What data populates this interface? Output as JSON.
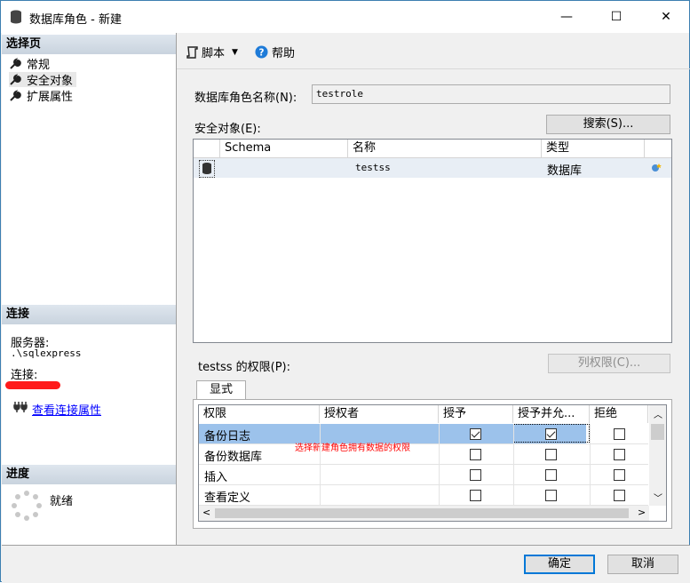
{
  "window": {
    "title": "数据库角色 - 新建",
    "controls": {
      "minimize": "—",
      "maximize": "☐",
      "close": "✕"
    }
  },
  "sidebar": {
    "select_page_header": "选择页",
    "pages": [
      {
        "label": "常规",
        "icon": "wrench-icon"
      },
      {
        "label": "安全对象",
        "icon": "wrench-icon"
      },
      {
        "label": "扩展属性",
        "icon": "wrench-icon"
      }
    ],
    "connection": {
      "header": "连接",
      "server_label": "服务器:",
      "server_value": ".\\sqlexpress",
      "connection_label": "连接:",
      "view_props_link": "查看连接属性"
    },
    "progress": {
      "header": "进度",
      "status": "就绪"
    }
  },
  "toolbar": {
    "script_label": "脚本",
    "help_label": "帮助"
  },
  "form": {
    "role_name_label": "数据库角色名称(N):",
    "role_name_value": "testrole",
    "securables_label": "安全对象(E):",
    "search_button": "搜索(S)..."
  },
  "securables_grid": {
    "columns": [
      "Schema",
      "名称",
      "类型"
    ],
    "rows": [
      {
        "schema": "",
        "name": "testss",
        "type": "数据库"
      }
    ]
  },
  "permissions": {
    "label": "testss 的权限(P):",
    "column_perm_button": "列权限(C)...",
    "tab_label": "显式",
    "columns": [
      "权限",
      "授权者",
      "授予",
      "授予并允...",
      "拒绝"
    ],
    "rows": [
      {
        "permission": "备份日志",
        "grantor": "",
        "grant": true,
        "with_grant": true,
        "deny": false
      },
      {
        "permission": "备份数据库",
        "grantor": "",
        "grant": false,
        "with_grant": false,
        "deny": false
      },
      {
        "permission": "插入",
        "grantor": "",
        "grant": false,
        "with_grant": false,
        "deny": false
      },
      {
        "permission": "查看定义",
        "grantor": "",
        "grant": false,
        "with_grant": false,
        "deny": false
      }
    ],
    "annotation": "选择新建角色拥有数据的权限"
  },
  "footer": {
    "ok_button": "确定",
    "cancel_button": "取消"
  },
  "colors": {
    "selected_row": "#9cc2eb",
    "section_header": "#d3dbe5",
    "link": "#0000ff",
    "annotation": "#ff0000",
    "redaction": "#ff0000"
  }
}
